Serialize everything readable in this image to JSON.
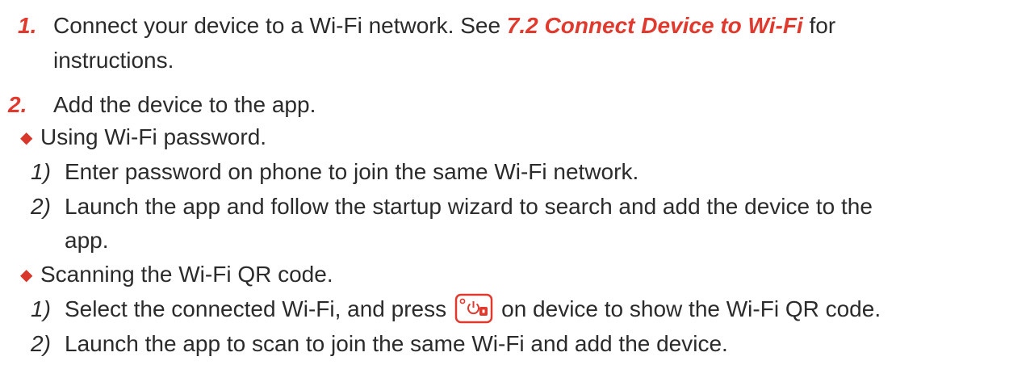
{
  "steps": [
    {
      "number": "1.",
      "text_before": "Connect your device to a Wi-Fi network. See ",
      "xref": "7.2 Connect Device to Wi-Fi",
      "text_after": " for",
      "continuation": "instructions."
    },
    {
      "number": "2.",
      "text": "Add the device to the app."
    }
  ],
  "methods": [
    {
      "title": "Using Wi-Fi password.",
      "substeps": [
        {
          "number": "1)",
          "text": "Enter password on phone to join the same Wi-Fi network."
        },
        {
          "number": "2)",
          "text": "Launch the app and follow the startup wizard to search and add the device to the",
          "continuation": "app."
        }
      ]
    },
    {
      "title": "Scanning the Wi-Fi QR code.",
      "substeps": [
        {
          "number": "1)",
          "text_before": "Select the connected Wi-Fi, and press",
          "icon": "power-button-icon",
          "text_after": "on device to show the Wi-Fi QR code."
        },
        {
          "number": "2)",
          "text": "Launch the app to scan to join the same Wi-Fi and add the device."
        }
      ]
    }
  ],
  "colors": {
    "accent": "#e03a2e",
    "text": "#2b2b2b"
  }
}
